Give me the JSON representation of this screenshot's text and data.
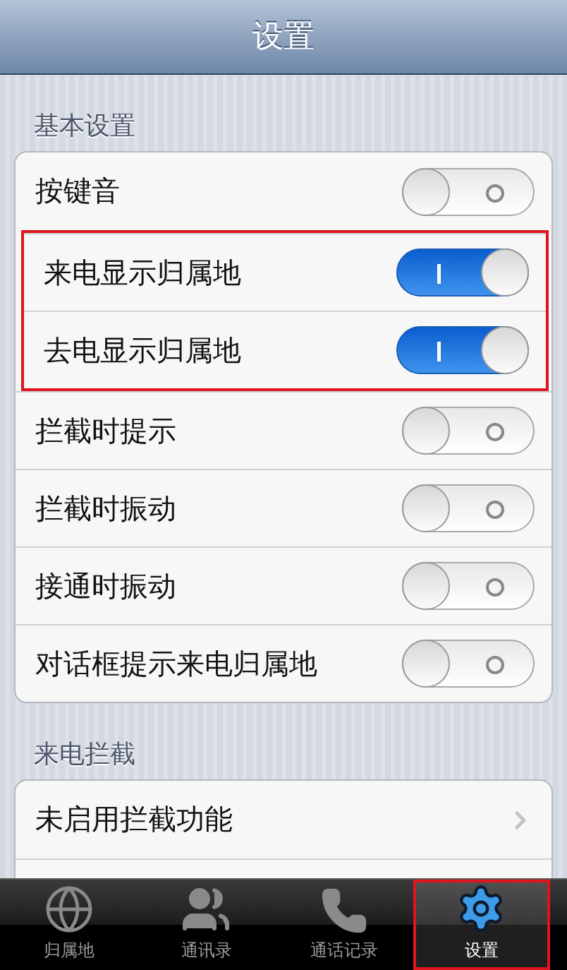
{
  "header": {
    "title": "设置"
  },
  "sections": [
    {
      "title": "基本设置",
      "rows": [
        {
          "kind": "switch",
          "label": "按键音",
          "on": false,
          "highlighted": false
        },
        {
          "kind": "switch",
          "label": "来电显示归属地",
          "on": true,
          "highlighted": true
        },
        {
          "kind": "switch",
          "label": "去电显示归属地",
          "on": true,
          "highlighted": true
        },
        {
          "kind": "switch",
          "label": "拦截时提示",
          "on": false,
          "highlighted": false
        },
        {
          "kind": "switch",
          "label": "拦截时振动",
          "on": false,
          "highlighted": false
        },
        {
          "kind": "switch",
          "label": "接通时振动",
          "on": false,
          "highlighted": false
        },
        {
          "kind": "switch",
          "label": "对话框提示来电归属地",
          "on": false,
          "highlighted": false
        }
      ]
    },
    {
      "title": "来电拦截",
      "rows": [
        {
          "kind": "link",
          "label": "未启用拦截功能",
          "highlighted": false
        }
      ]
    }
  ],
  "tabs": [
    {
      "kind": "globe",
      "label": "归属地",
      "selected": false,
      "highlighted": false
    },
    {
      "kind": "contacts",
      "label": "通讯录",
      "selected": false,
      "highlighted": false
    },
    {
      "kind": "phone",
      "label": "通话记录",
      "selected": false,
      "highlighted": false
    },
    {
      "kind": "gear",
      "label": "设置",
      "selected": true,
      "highlighted": true
    }
  ]
}
